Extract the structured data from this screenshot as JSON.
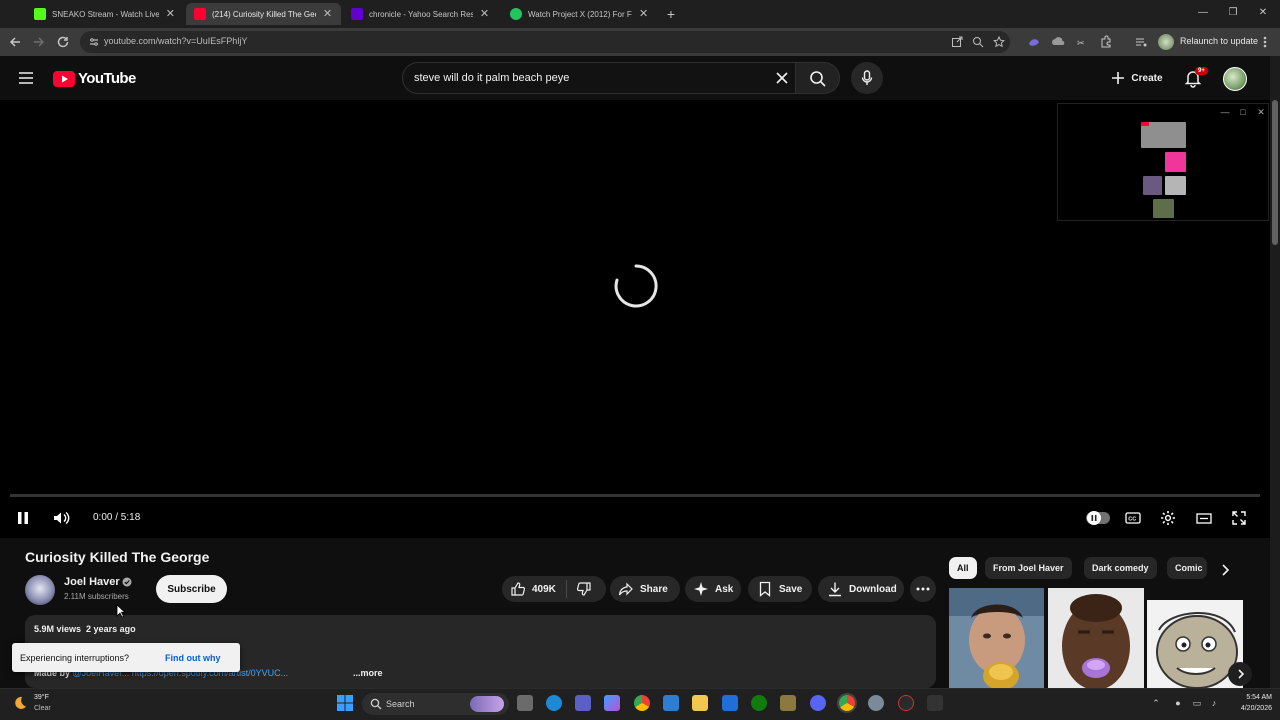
{
  "browser": {
    "tabs": [
      {
        "title": "SNEAKO Stream - Watch Live o",
        "favicon_color": "#53fc18",
        "active": false
      },
      {
        "title": "(214) Curiosity Killed The Georg",
        "favicon_color": "#ff0033",
        "active": true
      },
      {
        "title": "chronicle - Yahoo Search Resul",
        "favicon_color": "#6001d2",
        "active": false
      },
      {
        "title": "Watch Project X (2012) For Free",
        "favicon_color": "#22c55e",
        "active": false
      }
    ],
    "url": "youtube.com/watch?v=UuIEsFPhljY",
    "relaunch_label": "Relaunch to update"
  },
  "youtube": {
    "logo_text": "YouTube",
    "search_query": "steve will do it palm beach peye",
    "create_label": "Create",
    "notification_count": "9+"
  },
  "player": {
    "time": "0:00 / 5:18",
    "state": "loading",
    "progress": 0
  },
  "video": {
    "title": "Curiosity Killed The George",
    "channel": "Joel Haver",
    "subscribers": "2.11M subscribers",
    "subscribe_label": "Subscribe",
    "likes": "409K",
    "share_label": "Share",
    "ask_label": "Ask",
    "save_label": "Save",
    "download_label": "Download",
    "views": "5.9M views",
    "age": "2 years ago",
    "desc_prefix": "Made by",
    "desc_link": "@JoelHaver... https://open.spotify.com/artist/0YVUC...",
    "more_label": "...more"
  },
  "toast": {
    "text": "Experiencing interruptions?",
    "link": "Find out why"
  },
  "chips": [
    "All",
    "From Joel Haver",
    "Dark comedy",
    "Comic"
  ],
  "taskbar": {
    "temperature": "39°F",
    "condition": "Clear",
    "search_label": "Search",
    "time": "5:54 AM",
    "date": "4/20/2026"
  },
  "colors": {
    "brand_red": "#ff0033",
    "background": "#0f0f0f",
    "link_blue": "#3ea6ff"
  }
}
